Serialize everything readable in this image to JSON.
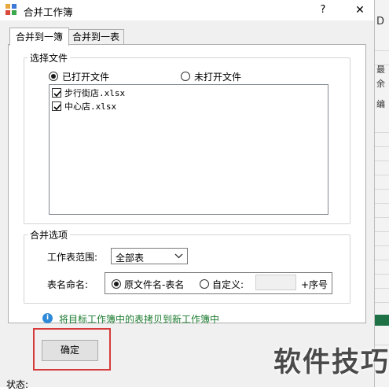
{
  "dialog": {
    "title": "合并工作簿",
    "help": "?",
    "close": "✕"
  },
  "tabs": [
    {
      "label": "合并到一簿",
      "active": true
    },
    {
      "label": "合并到一表",
      "active": false
    }
  ],
  "select_files": {
    "group_label": "选择文件",
    "radio_open": "已打开文件",
    "radio_unopened": "未打开文件",
    "selected_radio": "已打开文件",
    "files": [
      {
        "name": "步行街店.xlsx",
        "checked": true
      },
      {
        "name": "中心店.xlsx",
        "checked": true
      }
    ]
  },
  "merge_options": {
    "group_label": "合并选项",
    "sheet_range_label": "工作表范围:",
    "sheet_range_value": "全部表",
    "sheet_naming_label": "表名命名:",
    "radio_original": "原文件名-表名",
    "radio_custom": "自定义:",
    "selected_radio": "原文件名-表名",
    "custom_value": "",
    "suffix_label": "+序号"
  },
  "info": {
    "text": "将目标工作簿中的表拷贝到新工作簿中"
  },
  "ok_button": "确定",
  "status_label": "状态:",
  "watermark": "软件技巧",
  "background": {
    "letters": [
      "D",
      "最",
      "余",
      "编"
    ]
  },
  "colors": {
    "accent_green": "#1b7a2e",
    "info_blue": "#2e8ad8",
    "highlight_red": "#d63b3b"
  }
}
